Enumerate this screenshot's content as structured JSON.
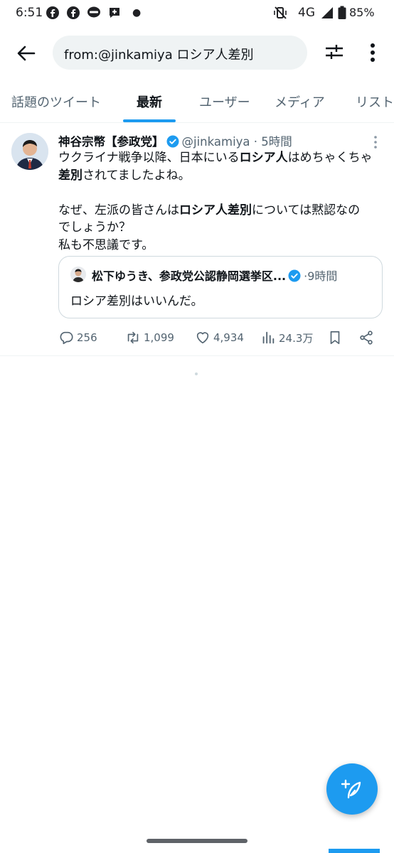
{
  "status_bar": {
    "time": "6:51",
    "network": "4G",
    "battery": "85%"
  },
  "search": {
    "query": "from:@jinkamiya ロシア人差別"
  },
  "tabs": [
    {
      "label": "話題のツイート",
      "active": false
    },
    {
      "label": "最新",
      "active": true
    },
    {
      "label": "ユーザー",
      "active": false
    },
    {
      "label": "メディア",
      "active": false
    },
    {
      "label": "リスト",
      "active": false
    }
  ],
  "tweet": {
    "name": "神谷宗幣【参政党】",
    "handle": "@jinkamiya",
    "separator": "·",
    "time": "5時間",
    "body": {
      "l1_a": "ウクライナ戦争以降、日本にいる",
      "l1_b": "ロシア人",
      "l1_c": "はめちゃくちゃ",
      "l2_a": "差別",
      "l2_b": "されてましたよね。",
      "l3_a": "なぜ、左派の皆さんは",
      "l3_b": "ロシア人差別",
      "l3_c": "については黙認なの",
      "l4": "でしょうか？",
      "l5": "私も不思議です。"
    },
    "quote": {
      "name": "松下ゆうき、参政党公認静岡選挙区...",
      "separator": "·",
      "time": "9時間",
      "body": "ロシア差別はいいんだ。"
    },
    "stats": {
      "replies": "256",
      "retweets": "1,099",
      "likes": "4,934",
      "views": "24.3万"
    }
  },
  "colors": {
    "accent": "#1d9bf0",
    "secondary_text": "#536471",
    "primary_text": "#0f1419"
  }
}
